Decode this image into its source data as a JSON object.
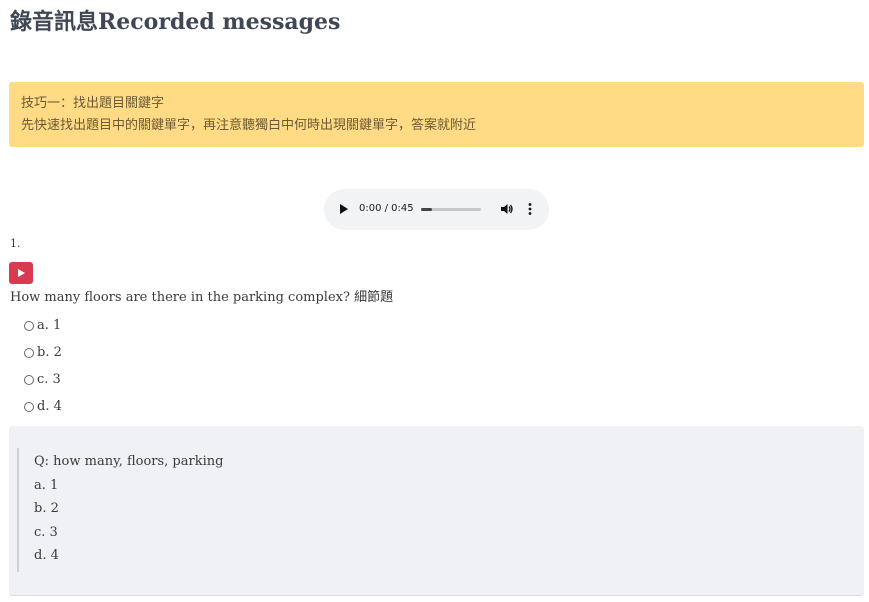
{
  "page": {
    "title": "錄音訊息Recorded messages"
  },
  "tip": {
    "title": "技巧一：找出題目關鍵字",
    "body": "先快速找出題目中的關鍵單字，再注意聽獨白中何時出現關鍵單字，答案就附近"
  },
  "audio": {
    "time": "0:00 / 0:45",
    "progress_fraction": 0.18,
    "icons": [
      "play-icon",
      "volume-icon",
      "more-vertical-icon"
    ]
  },
  "question": {
    "number": "1.",
    "text": "How many floors are there in the parking complex? 細節題",
    "options": [
      "a. 1",
      "b. 2",
      "c. 3",
      "d. 4"
    ]
  },
  "answer": {
    "lines": [
      "Q: how many, floors, parking",
      "a. 1",
      "b. 2",
      "c. 3",
      "d. 4"
    ]
  },
  "colors": {
    "tip_bg": "#ffdb86",
    "play_button": "#d93a4f",
    "panel_bg": "#f0f1f4"
  }
}
